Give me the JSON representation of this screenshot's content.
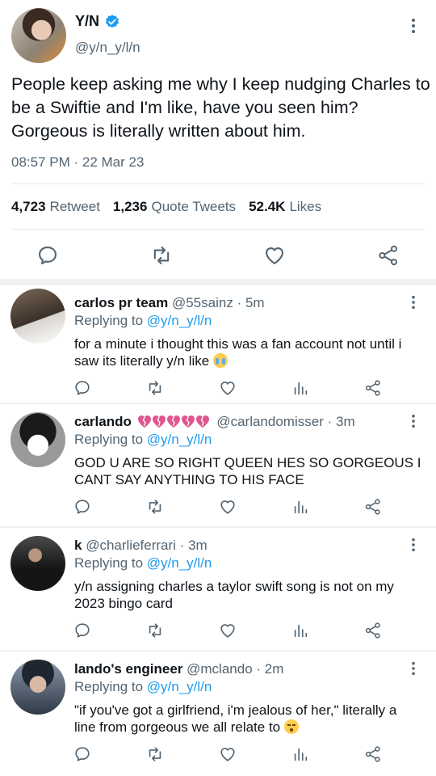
{
  "tweet": {
    "author_name": "Y/N",
    "author_handle": "@y/n_y/l/n",
    "text": "People keep asking me why I keep nudging Charles to be a Swiftie and I'm like, have you seen him? Gorgeous is literally written about him.",
    "time": "08:57 PM",
    "date": "22 Mar 23",
    "stats": {
      "retweets": "4,723",
      "retweets_label": "Retweet",
      "quotes": "1,236",
      "quotes_label": "Quote Tweets",
      "likes": "52.4K",
      "likes_label": "Likes"
    }
  },
  "replying_to_label": "Replying to",
  "replies": [
    {
      "name": "carlos pr team",
      "handle": "@55sainz",
      "age": "5m",
      "replying_to": "@y/n_y/l/n",
      "text": "for a minute i thought this was a fan account not until i saw its literally y/n like",
      "emoji": "loudly-crying-face"
    },
    {
      "name": "carlando",
      "handle": "@carlandomisser",
      "age": "3m",
      "replying_to": "@y/n_y/l/n",
      "text": "GOD U ARE SO RIGHT QUEEN HES SO GORGEOUS I CANT SAY ANYTHING TO HIS FACE",
      "name_emoji": "broken-hearts"
    },
    {
      "name": "k",
      "handle": "@charlieferrari",
      "age": "3m",
      "replying_to": "@y/n_y/l/n",
      "text": "y/n assigning charles a taylor swift song is not on my 2023 bingo card"
    },
    {
      "name": "lando's engineer",
      "handle": "@mclando",
      "age": "2m",
      "replying_to": "@y/n_y/l/n",
      "text": "\"if you've got a girlfriend, i'm jealous of her,\" literally a line from gorgeous we all relate to",
      "emoji": "kissing-face"
    }
  ],
  "colors": {
    "accent": "#1d9bf0",
    "muted": "#536471",
    "text": "#0f1419"
  },
  "icons": [
    "verified-badge-icon",
    "more-icon",
    "reply-icon",
    "retweet-icon",
    "like-icon",
    "share-icon",
    "views-icon"
  ]
}
